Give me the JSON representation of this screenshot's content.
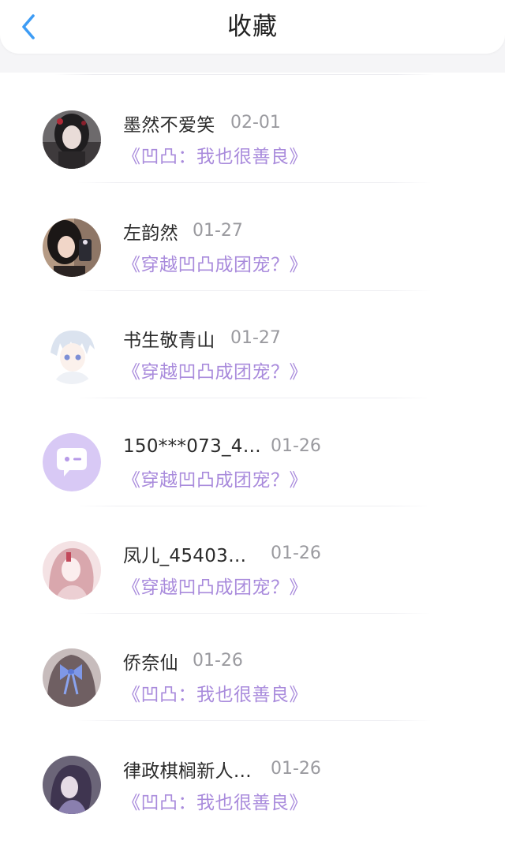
{
  "header": {
    "title": "收藏",
    "back_icon": "chevron-left-icon",
    "accent": "#3d9cf5"
  },
  "colors": {
    "book_link": "#a98bdc",
    "name": "#2b2b2b",
    "date": "#9a9a9f"
  },
  "items": [
    {
      "name": "墨然不爱笑",
      "date": "02-01",
      "book": "《凹凸：我也很善良》",
      "avatar": "avatar-girl-dark-hair"
    },
    {
      "name": "左韵然",
      "date": "01-27",
      "book": "《穿越凹凸成团宠？》",
      "avatar": "avatar-girl-photo"
    },
    {
      "name": "书生敬青山",
      "date": "01-27",
      "book": "《穿越凹凸成团宠？》",
      "avatar": "avatar-anime-white-hair"
    },
    {
      "name": "150***073_4…",
      "date": "01-26",
      "book": "《穿越凹凸成团宠？》",
      "avatar": "default-chat-avatar-icon"
    },
    {
      "name": "凤儿_45403…",
      "date": "01-26",
      "book": "《穿越凹凸成团宠？》",
      "avatar": "avatar-anime-pink"
    },
    {
      "name": "侨奈仙",
      "date": "01-26",
      "book": "《凹凸：我也很善良》",
      "avatar": "avatar-blue-bow"
    },
    {
      "name": "律政棋榈新人…",
      "date": "01-26",
      "book": "《凹凸：我也很善良》",
      "avatar": "avatar-anime-purple"
    }
  ]
}
